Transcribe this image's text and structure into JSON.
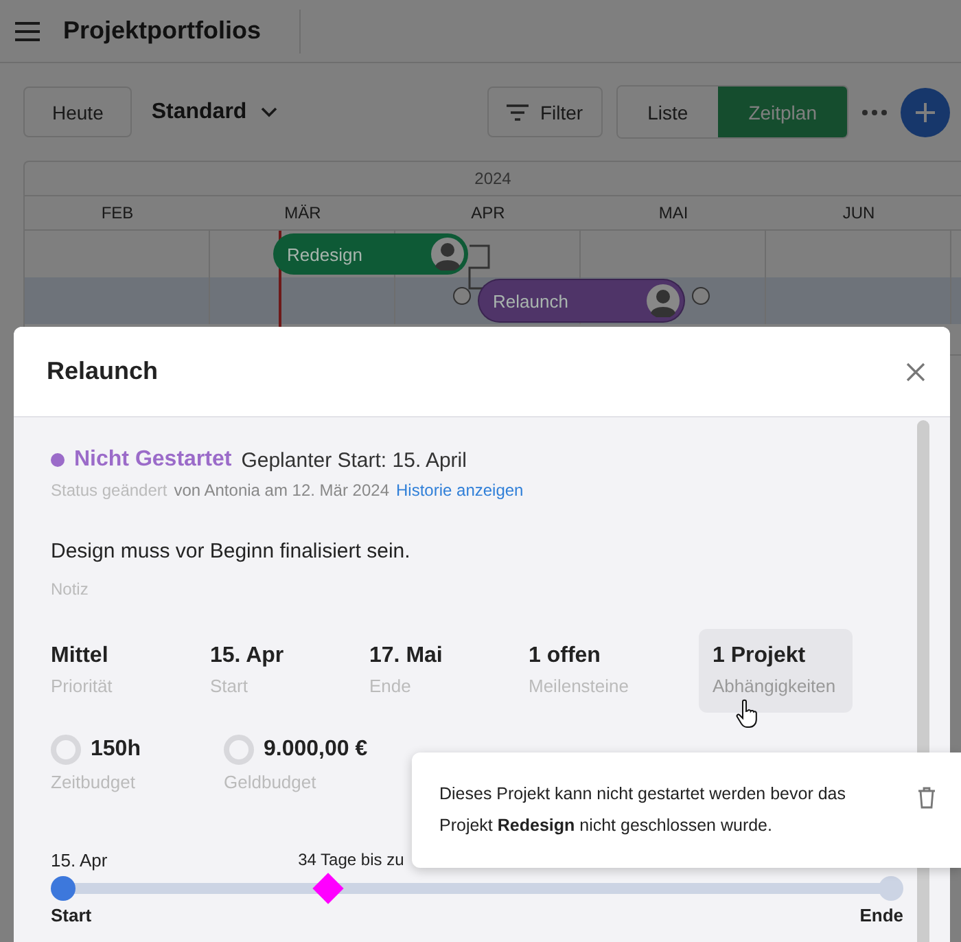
{
  "header": {
    "title": "Projektportfolios"
  },
  "toolbar": {
    "today_button": "Heute",
    "view_select": "Standard",
    "filter_button": "Filter",
    "view_tabs": [
      {
        "label": "Liste",
        "selected": false
      },
      {
        "label": "Zeitplan",
        "selected": true
      }
    ]
  },
  "timeline": {
    "year": "2024",
    "months": [
      "FEB",
      "MÄR",
      "APR",
      "MAI",
      "JUN"
    ],
    "bars": [
      {
        "label": "Redesign",
        "color": "#0e5a36",
        "selected": false
      },
      {
        "label": "Relaunch",
        "color": "#4f3468",
        "selected": true
      }
    ]
  },
  "dialog": {
    "title": "Relaunch",
    "status": {
      "label": "Nicht Gestartet",
      "color": "#9b6bc9",
      "planned_start": "Geplanter Start: 15. April"
    },
    "status_changed": {
      "label": "Status geändert",
      "by": "von Antonia am 12. Mär 2024",
      "link": "Historie anzeigen"
    },
    "note": {
      "text": "Design muss vor Beginn finalisiert sein.",
      "label": "Notiz"
    },
    "facts": [
      {
        "value": "Mittel",
        "label": "Priorität",
        "highlighted": false
      },
      {
        "value": "15. Apr",
        "label": "Start",
        "highlighted": false
      },
      {
        "value": "17. Mai",
        "label": "Ende",
        "highlighted": false
      },
      {
        "value": "1 offen",
        "label": "Meilensteine",
        "highlighted": false
      },
      {
        "value": "1 Projekt",
        "label": "Abhängigkeiten",
        "highlighted": true
      }
    ],
    "budgets": [
      {
        "value": "150h",
        "label": "Zeitbudget"
      },
      {
        "value": "9.000,00 €",
        "label": "Geldbudget"
      }
    ],
    "progress": {
      "start_date": "15. Apr",
      "caption": "34 Tage bis zu",
      "start_label": "Start",
      "end_label": "Ende",
      "level": 0.32
    }
  },
  "tooltip": {
    "text": "Dieses Projekt kann nicht gestartet werden bevor das Projekt **Redesign** nicht geschlossen wurde."
  }
}
